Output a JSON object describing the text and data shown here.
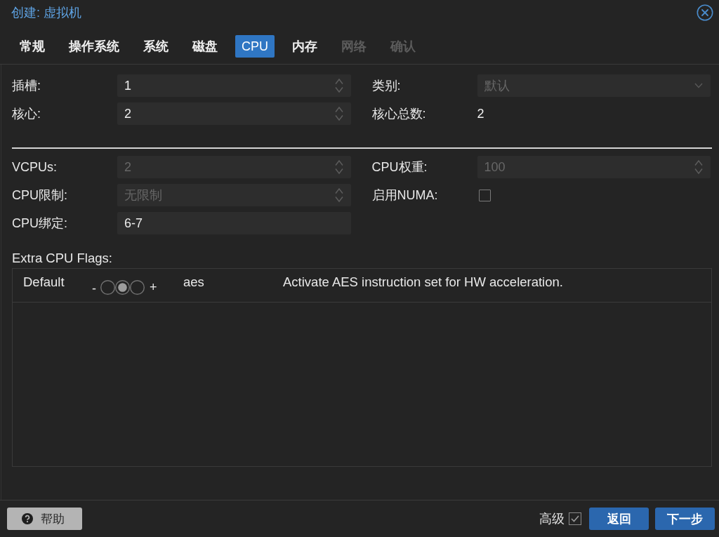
{
  "window": {
    "title": "创建: 虚拟机"
  },
  "tabs": [
    {
      "label": "常规",
      "selected": false,
      "disabled": false
    },
    {
      "label": "操作系统",
      "selected": false,
      "disabled": false
    },
    {
      "label": "系统",
      "selected": false,
      "disabled": false
    },
    {
      "label": "磁盘",
      "selected": false,
      "disabled": false
    },
    {
      "label": "CPU",
      "selected": true,
      "disabled": false
    },
    {
      "label": "内存",
      "selected": false,
      "disabled": false
    },
    {
      "label": "网络",
      "selected": false,
      "disabled": true
    },
    {
      "label": "确认",
      "selected": false,
      "disabled": true
    }
  ],
  "basic": {
    "left": [
      {
        "kind": "spinner",
        "label": "插槽:",
        "value": "1"
      },
      {
        "kind": "spinner",
        "label": "核心:",
        "value": "2"
      }
    ],
    "right": [
      {
        "kind": "dropdown",
        "label": "类别:",
        "placeholder": "默认"
      },
      {
        "kind": "display",
        "label": "核心总数:",
        "value": "2"
      }
    ]
  },
  "advanced": {
    "left": [
      {
        "kind": "spinner",
        "label": "VCPUs:",
        "placeholder": "2"
      },
      {
        "kind": "spinner",
        "label": "CPU限制:",
        "placeholder": "无限制"
      },
      {
        "kind": "text",
        "label": "CPU绑定:",
        "value": "6-7"
      }
    ],
    "right": [
      {
        "kind": "spinner",
        "label": "CPU权重:",
        "placeholder": "100"
      },
      {
        "kind": "checkbox",
        "label": "启用NUMA:",
        "checked": false
      }
    ]
  },
  "cpu_flags": {
    "label": "Extra CPU Flags:",
    "rows": [
      {
        "state": "Default",
        "minus": "-",
        "options": [
          {
            "selected": false
          },
          {
            "selected": true
          },
          {
            "selected": false
          }
        ],
        "plus": "+",
        "flag": "aes",
        "description": "Activate AES instruction set for HW acceleration."
      }
    ]
  },
  "footer": {
    "help_button": "帮助",
    "advanced_toggle": {
      "label": "高级",
      "checked": true
    },
    "buttons": [
      "返回",
      "下一步"
    ]
  }
}
